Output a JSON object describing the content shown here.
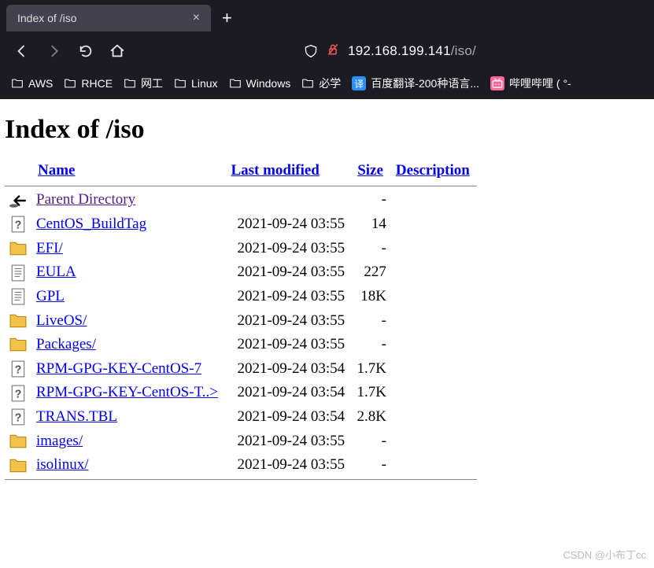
{
  "chrome": {
    "tab_title": "Index of /iso",
    "url_host": "192.168.199.141",
    "url_path": "/iso/",
    "bookmarks": [
      {
        "label": "AWS",
        "type": "folder"
      },
      {
        "label": "RHCE",
        "type": "folder"
      },
      {
        "label": "网工",
        "type": "folder"
      },
      {
        "label": "Linux",
        "type": "folder"
      },
      {
        "label": "Windows",
        "type": "folder"
      },
      {
        "label": "必学",
        "type": "folder"
      },
      {
        "label": "百度翻译-200种语言...",
        "type": "icon-translate"
      },
      {
        "label": "哔哩哔哩 (  °-",
        "type": "icon-bili"
      }
    ]
  },
  "page": {
    "heading": "Index of /iso",
    "columns": {
      "name": "Name",
      "modified": "Last modified",
      "size": "Size",
      "desc": "Description"
    },
    "rows": [
      {
        "icon": "back",
        "name": "Parent Directory",
        "modified": "",
        "size": "-",
        "visited": true
      },
      {
        "icon": "unknown",
        "name": "CentOS_BuildTag",
        "modified": "2021-09-24 03:55",
        "size": "14"
      },
      {
        "icon": "folder",
        "name": "EFI/",
        "modified": "2021-09-24 03:55",
        "size": "-"
      },
      {
        "icon": "text",
        "name": "EULA",
        "modified": "2021-09-24 03:55",
        "size": "227"
      },
      {
        "icon": "text",
        "name": "GPL",
        "modified": "2021-09-24 03:55",
        "size": "18K"
      },
      {
        "icon": "folder",
        "name": "LiveOS/",
        "modified": "2021-09-24 03:55",
        "size": "-"
      },
      {
        "icon": "folder",
        "name": "Packages/",
        "modified": "2021-09-24 03:55",
        "size": "-"
      },
      {
        "icon": "unknown",
        "name": "RPM-GPG-KEY-CentOS-7",
        "modified": "2021-09-24 03:54",
        "size": "1.7K"
      },
      {
        "icon": "unknown",
        "name": "RPM-GPG-KEY-CentOS-T..>",
        "modified": "2021-09-24 03:54",
        "size": "1.7K"
      },
      {
        "icon": "unknown",
        "name": "TRANS.TBL",
        "modified": "2021-09-24 03:54",
        "size": "2.8K"
      },
      {
        "icon": "folder",
        "name": "images/",
        "modified": "2021-09-24 03:55",
        "size": "-"
      },
      {
        "icon": "folder",
        "name": "isolinux/",
        "modified": "2021-09-24 03:55",
        "size": "-"
      }
    ]
  },
  "watermark": "CSDN @小布丁cc"
}
